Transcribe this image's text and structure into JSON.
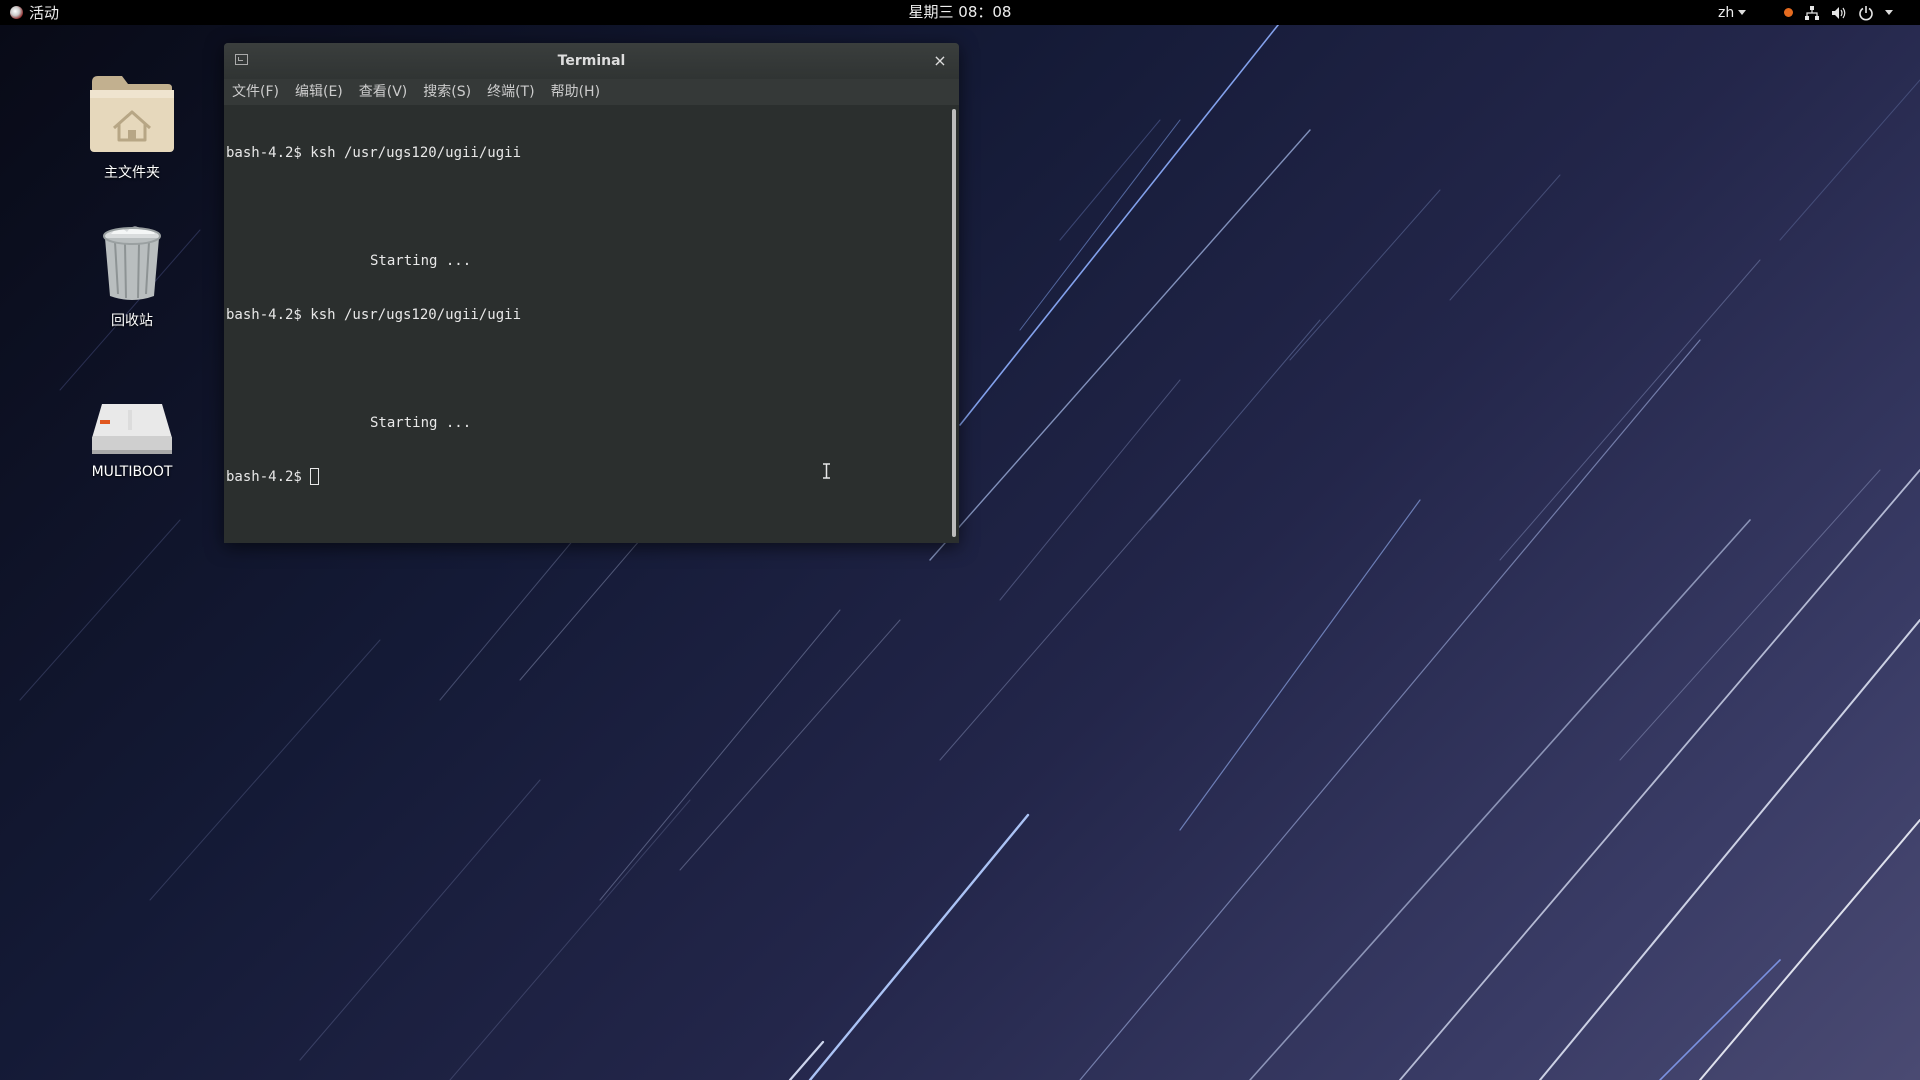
{
  "top_bar": {
    "activities_label": "活动",
    "clock": "星期三 08：08",
    "language": "zh",
    "tray": {
      "recording_indicator_color": "#e56b1f",
      "icons": [
        "record-indicator-icon",
        "network-icon",
        "volume-icon",
        "power-icon",
        "chevron-down-icon"
      ]
    }
  },
  "desktop": {
    "icons": [
      {
        "label": "主文件夹",
        "icon": "home-folder-icon"
      },
      {
        "label": "回收站",
        "icon": "trash-icon"
      },
      {
        "label": "MULTIBOOT",
        "icon": "drive-icon"
      }
    ]
  },
  "terminal": {
    "title": "Terminal",
    "close_glyph": "×",
    "menu": [
      "文件(F)",
      "编辑(E)",
      "查看(V)",
      "搜索(S)",
      "终端(T)",
      "帮助(H)"
    ],
    "lines": [
      {
        "text": "bash-4.2$ ksh /usr/ugs120/ugii/ugii"
      },
      {
        "text": "Starting ..."
      },
      {
        "text": "bash-4.2$ ksh /usr/ugs120/ugii/ugii"
      },
      {
        "text": "Starting ..."
      },
      {
        "text": "bash-4.2$"
      }
    ]
  },
  "colors": {
    "terminal_bg": "#2b2f2e",
    "top_bar_bg": "#000000",
    "terminal_fg": "#e8e8e8"
  }
}
